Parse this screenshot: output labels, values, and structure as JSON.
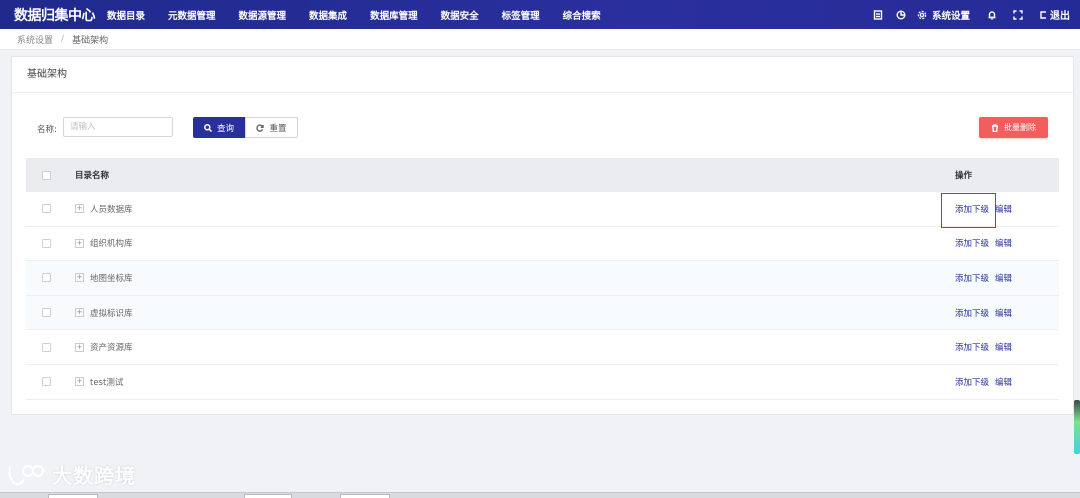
{
  "topbar": {
    "logo": "数据归集中心",
    "nav": [
      "数据目录",
      "元数据管理",
      "数据源管理",
      "数据集成",
      "数据库管理",
      "数据安全",
      "标签管理",
      "综合搜索"
    ],
    "settings_label": "系统设置",
    "logout_label": "退出",
    "icons": [
      "doc-icon",
      "pie-chart-icon",
      "gear-icon",
      "bell-icon",
      "fullscreen-icon",
      "logout-icon"
    ]
  },
  "breadcrumb": {
    "root": "系统设置",
    "separator": "/",
    "current": "基础架构"
  },
  "card": {
    "title": "基础架构"
  },
  "filter": {
    "name_label": "名称:",
    "name_placeholder": "请输入",
    "query_label": "查询",
    "reset_label": "重置",
    "batch_delete_label": "批量删除"
  },
  "table": {
    "headers": {
      "name": "目录名称",
      "action": "操作"
    },
    "rows": [
      {
        "name": "人员数据库",
        "add_child": "添加下级",
        "edit": "编辑"
      },
      {
        "name": "组织机构库",
        "add_child": "添加下级",
        "edit": "编辑"
      },
      {
        "name": "地图坐标库",
        "add_child": "添加下级",
        "edit": "编辑"
      },
      {
        "name": "虚拟标识库",
        "add_child": "添加下级",
        "edit": "编辑"
      },
      {
        "name": "资产资源库",
        "add_child": "添加下级",
        "edit": "编辑"
      },
      {
        "name": "test测试",
        "add_child": "添加下级",
        "edit": "编辑"
      }
    ]
  },
  "watermark": {
    "text": "大数跨境"
  },
  "colors": {
    "primary": "#28309b",
    "danger": "#f35d5d",
    "highlight": "#e0252a"
  }
}
